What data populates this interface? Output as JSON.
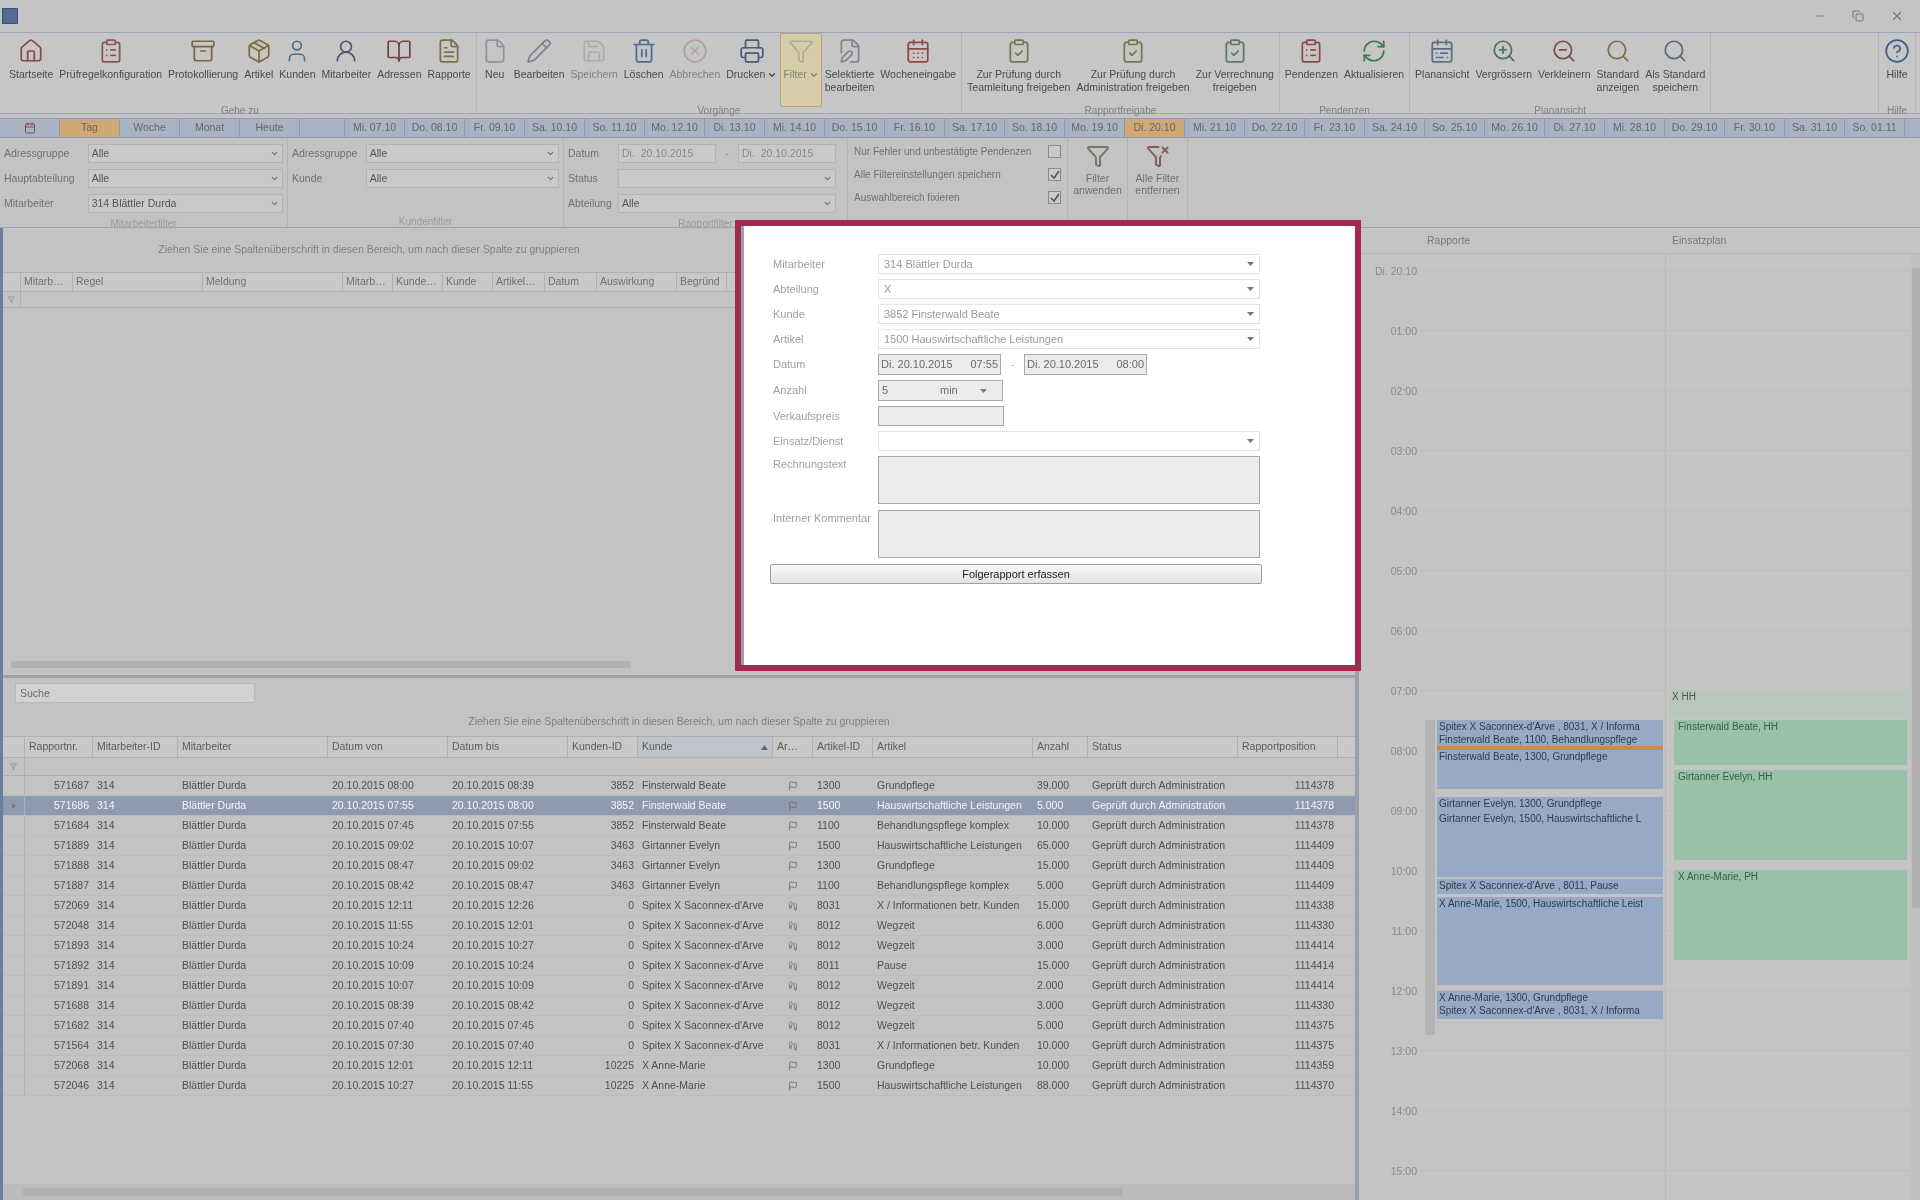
{
  "ribbon": {
    "groups": [
      {
        "caption": "Gehe zu",
        "buttons": [
          {
            "label": "Startseite",
            "disabled": false,
            "selected": false,
            "menu": false
          },
          {
            "label": "Prüfregelkonfiguration",
            "disabled": false,
            "selected": false,
            "menu": false
          },
          {
            "label": "Protokollierung",
            "disabled": false,
            "selected": false,
            "menu": false
          },
          {
            "label": "Artikel",
            "disabled": false,
            "selected": false,
            "menu": false
          },
          {
            "label": "Kunden",
            "disabled": false,
            "selected": false,
            "menu": false
          },
          {
            "label": "Mitarbeiter",
            "disabled": false,
            "selected": false,
            "menu": false
          },
          {
            "label": "Adressen",
            "disabled": false,
            "selected": false,
            "menu": false
          },
          {
            "label": "Rapporte",
            "disabled": false,
            "selected": false,
            "menu": false
          }
        ]
      },
      {
        "caption": "Vorgänge",
        "buttons": [
          {
            "label": "Neu",
            "disabled": false,
            "selected": false,
            "menu": false
          },
          {
            "label": "Bearbeiten",
            "disabled": false,
            "selected": false,
            "menu": false
          },
          {
            "label": "Speichern",
            "disabled": true,
            "selected": false,
            "menu": false
          },
          {
            "label": "Löschen",
            "disabled": false,
            "selected": false,
            "menu": false
          },
          {
            "label": "Abbrechen",
            "disabled": true,
            "selected": false,
            "menu": false
          },
          {
            "label": "Drucken",
            "disabled": false,
            "selected": false,
            "menu": true
          },
          {
            "label": "Filter",
            "disabled": true,
            "selected": true,
            "menu": true
          },
          {
            "label": "Selektierte\nbearbeiten",
            "disabled": false,
            "selected": false,
            "menu": false
          },
          {
            "label": "Wocheneingabe",
            "disabled": false,
            "selected": false,
            "menu": false
          }
        ]
      },
      {
        "caption": "Rapportfreigabe",
        "buttons": [
          {
            "label": "Zur Prüfung durch\nTeamleitung freigeben",
            "disabled": false,
            "selected": false,
            "menu": false
          },
          {
            "label": "Zur Prüfung durch\nAdministration freigeben",
            "disabled": false,
            "selected": false,
            "menu": false
          },
          {
            "label": "Zur Verrechnung\nfreigeben",
            "disabled": false,
            "selected": false,
            "menu": false
          }
        ]
      },
      {
        "caption": "Pendenzen",
        "buttons": [
          {
            "label": "Pendenzen",
            "disabled": false,
            "selected": false,
            "menu": false
          },
          {
            "label": "Aktualisieren",
            "disabled": false,
            "selected": false,
            "menu": false
          }
        ]
      },
      {
        "caption": "Planansicht",
        "buttons": [
          {
            "label": "Planansicht",
            "disabled": false,
            "selected": false,
            "menu": false
          },
          {
            "label": "Vergrössern",
            "disabled": false,
            "selected": false,
            "menu": false
          },
          {
            "label": "Verkleinern",
            "disabled": false,
            "selected": false,
            "menu": false
          },
          {
            "label": "Standard\nanzeigen",
            "disabled": false,
            "selected": false,
            "menu": false
          },
          {
            "label": "Als Standard\nspeichern",
            "disabled": false,
            "selected": false,
            "menu": false
          }
        ]
      },
      {
        "caption": "Hilfe",
        "buttons": [
          {
            "label": "Hilfe",
            "disabled": false,
            "selected": false,
            "menu": false
          }
        ]
      }
    ]
  },
  "date_strip": {
    "views": [
      {
        "label": "Tag",
        "selected": true
      },
      {
        "label": "Woche",
        "selected": false
      },
      {
        "label": "Monat",
        "selected": false
      },
      {
        "label": "Heute",
        "selected": false
      }
    ],
    "days": [
      {
        "label": "Mi. 07.10",
        "selected": false
      },
      {
        "label": "Do. 08.10",
        "selected": false
      },
      {
        "label": "Fr. 09.10",
        "selected": false
      },
      {
        "label": "Sa. 10.10",
        "selected": false
      },
      {
        "label": "So. 11.10",
        "selected": false
      },
      {
        "label": "Mo. 12.10",
        "selected": false
      },
      {
        "label": "Di. 13.10",
        "selected": false
      },
      {
        "label": "Mi. 14.10",
        "selected": false
      },
      {
        "label": "Do. 15.10",
        "selected": false
      },
      {
        "label": "Fr. 16.10",
        "selected": false
      },
      {
        "label": "Sa. 17.10",
        "selected": false
      },
      {
        "label": "So. 18.10",
        "selected": false
      },
      {
        "label": "Mo. 19.10",
        "selected": false
      },
      {
        "label": "Di. 20.10",
        "selected": true
      },
      {
        "label": "Mi. 21.10",
        "selected": false
      },
      {
        "label": "Do. 22.10",
        "selected": false
      },
      {
        "label": "Fr. 23.10",
        "selected": false
      },
      {
        "label": "Sa. 24.10",
        "selected": false
      },
      {
        "label": "So. 25.10",
        "selected": false
      },
      {
        "label": "Mo. 26.10",
        "selected": false
      },
      {
        "label": "Di. 27.10",
        "selected": false
      },
      {
        "label": "Mi. 28.10",
        "selected": false
      },
      {
        "label": "Do. 29.10",
        "selected": false
      },
      {
        "label": "Fr. 30.10",
        "selected": false
      },
      {
        "label": "Sa. 31.10",
        "selected": false
      },
      {
        "label": "So. 01.11",
        "selected": false
      }
    ]
  },
  "filters": {
    "groups": [
      {
        "caption": "Mitarbeiterfilter",
        "fields": [
          {
            "label": "Adressgruppe",
            "value": "Alle"
          },
          {
            "label": "Hauptabteilung",
            "value": "Alle"
          },
          {
            "label": "Mitarbeiter",
            "value": "314 Blättler Durda"
          }
        ]
      },
      {
        "caption": "Kundenfilter",
        "fields": [
          {
            "label": "Adressgruppe",
            "value": "Alle"
          },
          {
            "label": "Kunde",
            "value": "Alle"
          }
        ]
      },
      {
        "caption": "Rapportfilter",
        "date": {
          "label": "Datum",
          "from": "Di.  20.10.2015",
          "separator": "-",
          "to": "Di.  20.10.2015"
        },
        "fields": [
          {
            "label": "Status"
          },
          {
            "label": "Abteilung",
            "value": "Alle"
          }
        ]
      }
    ],
    "options": [
      {
        "label": "Nur Fehler und unbestätigte Pendenzen",
        "checked": false
      },
      {
        "label": "Alle Filtereinstellungen speichern",
        "checked": true
      },
      {
        "label": "Auswahlbereich fixieren",
        "checked": true
      }
    ],
    "buttons": [
      "Filter\nanwenden",
      "Alle Filter\nentfernen"
    ]
  },
  "check_grid": {
    "group_hint": "Ziehen Sie eine Spaltenüberschrift in diesen Bereich, um nach dieser Spalte zu gruppieren",
    "columns": [
      "Mitarb…",
      "Regel",
      "Meldung",
      "Mitarb…",
      "Kunde…",
      "Kunde",
      "Artikel…",
      "Datum",
      "Auswirkung",
      "Begründ"
    ]
  },
  "report_grid": {
    "search": {
      "placeholder": "Suche"
    },
    "group_hint": "Ziehen Sie eine Spaltenüberschrift in diesen Bereich, um nach dieser Spalte zu gruppieren",
    "columns": [
      {
        "label": "Rapportnr.",
        "sorted": false
      },
      {
        "label": "Mitarbeiter-ID",
        "sorted": false
      },
      {
        "label": "Mitarbeiter",
        "sorted": false
      },
      {
        "label": "Datum von",
        "sorted": false
      },
      {
        "label": "Datum bis",
        "sorted": false
      },
      {
        "label": "Kunden-ID",
        "sorted": false
      },
      {
        "label": "Kunde",
        "sorted": true
      },
      {
        "label": "Ar…",
        "sorted": false
      },
      {
        "label": "Artikel-ID",
        "sorted": false
      },
      {
        "label": "Artikel",
        "sorted": false
      },
      {
        "label": "Anzahl",
        "sorted": false
      },
      {
        "label": "Status",
        "sorted": false
      },
      {
        "label": "Rapportposition",
        "sorted": false
      }
    ],
    "rows": [
      {
        "selected": false,
        "cells": [
          "571687",
          "314",
          "Blättler Durda",
          "20.10.2015 08:00",
          "20.10.2015 08:39",
          "3852",
          "Finsterwald Beate",
          {
            "kind": "client"
          },
          "1300",
          "Grundpflege",
          "39.000",
          "Geprüft durch Administration",
          "1114378"
        ]
      },
      {
        "selected": true,
        "cells": [
          "571686",
          "314",
          "Blättler Durda",
          "20.10.2015 07:55",
          "20.10.2015 08:00",
          "3852",
          "Finsterwald Beate",
          {
            "kind": "client"
          },
          "1500",
          "Hauswirtschaftliche Leistungen",
          "5.000",
          "Geprüft durch Administration",
          "1114378"
        ]
      },
      {
        "selected": false,
        "cells": [
          "571684",
          "314",
          "Blättler Durda",
          "20.10.2015 07:45",
          "20.10.2015 07:55",
          "3852",
          "Finsterwald Beate",
          {
            "kind": "client"
          },
          "1100",
          "Behandlungspflege komplex",
          "10.000",
          "Geprüft durch Administration",
          "1114378"
        ]
      },
      {
        "selected": false,
        "cells": [
          "571889",
          "314",
          "Blättler Durda",
          "20.10.2015 09:02",
          "20.10.2015 10:07",
          "3463",
          "Girtanner Evelyn",
          {
            "kind": "client"
          },
          "1500",
          "Hauswirtschaftliche Leistungen",
          "65.000",
          "Geprüft durch Administration",
          "1114409"
        ]
      },
      {
        "selected": false,
        "cells": [
          "571888",
          "314",
          "Blättler Durda",
          "20.10.2015 08:47",
          "20.10.2015 09:02",
          "3463",
          "Girtanner Evelyn",
          {
            "kind": "client"
          },
          "1300",
          "Grundpflege",
          "15.000",
          "Geprüft durch Administration",
          "1114409"
        ]
      },
      {
        "selected": false,
        "cells": [
          "571887",
          "314",
          "Blättler Durda",
          "20.10.2015 08:42",
          "20.10.2015 08:47",
          "3463",
          "Girtanner Evelyn",
          {
            "kind": "client"
          },
          "1100",
          "Behandlungspflege komplex",
          "5.000",
          "Geprüft durch Administration",
          "1114409"
        ]
      },
      {
        "selected": false,
        "cells": [
          "572069",
          "314",
          "Blättler Durda",
          "20.10.2015 12:11",
          "20.10.2015 12:26",
          "0",
          "Spitex X Saconnex-d'Arve",
          {
            "kind": "internal"
          },
          "8031",
          "X / Informationen betr. Kunden",
          "15.000",
          "Geprüft durch Administration",
          "1114338"
        ]
      },
      {
        "selected": false,
        "cells": [
          "572048",
          "314",
          "Blättler Durda",
          "20.10.2015 11:55",
          "20.10.2015 12:01",
          "0",
          "Spitex X Saconnex-d'Arve",
          {
            "kind": "internal"
          },
          "8012",
          "Wegzeit",
          "6.000",
          "Geprüft durch Administration",
          "1114330"
        ]
      },
      {
        "selected": false,
        "cells": [
          "571893",
          "314",
          "Blättler Durda",
          "20.10.2015 10:24",
          "20.10.2015 10:27",
          "0",
          "Spitex X Saconnex-d'Arve",
          {
            "kind": "internal"
          },
          "8012",
          "Wegzeit",
          "3.000",
          "Geprüft durch Administration",
          "1114414"
        ]
      },
      {
        "selected": false,
        "cells": [
          "571892",
          "314",
          "Blättler Durda",
          "20.10.2015 10:09",
          "20.10.2015 10:24",
          "0",
          "Spitex X Saconnex-d'Arve",
          {
            "kind": "internal"
          },
          "8011",
          "Pause",
          "15.000",
          "Geprüft durch Administration",
          "1114414"
        ]
      },
      {
        "selected": false,
        "cells": [
          "571891",
          "314",
          "Blättler Durda",
          "20.10.2015 10:07",
          "20.10.2015 10:09",
          "0",
          "Spitex X Saconnex-d'Arve",
          {
            "kind": "internal"
          },
          "8012",
          "Wegzeit",
          "2.000",
          "Geprüft durch Administration",
          "1114414"
        ]
      },
      {
        "selected": false,
        "cells": [
          "571688",
          "314",
          "Blättler Durda",
          "20.10.2015 08:39",
          "20.10.2015 08:42",
          "0",
          "Spitex X Saconnex-d'Arve",
          {
            "kind": "internal"
          },
          "8012",
          "Wegzeit",
          "3.000",
          "Geprüft durch Administration",
          "1114330"
        ]
      },
      {
        "selected": false,
        "cells": [
          "571682",
          "314",
          "Blättler Durda",
          "20.10.2015 07:40",
          "20.10.2015 07:45",
          "0",
          "Spitex X Saconnex-d'Arve",
          {
            "kind": "internal"
          },
          "8012",
          "Wegzeit",
          "5.000",
          "Geprüft durch Administration",
          "1114375"
        ]
      },
      {
        "selected": false,
        "cells": [
          "571564",
          "314",
          "Blättler Durda",
          "20.10.2015 07:30",
          "20.10.2015 07:40",
          "0",
          "Spitex X Saconnex-d'Arve",
          {
            "kind": "internal"
          },
          "8031",
          "X / Informationen betr. Kunden",
          "10.000",
          "Geprüft durch Administration",
          "1114375"
        ]
      },
      {
        "selected": false,
        "cells": [
          "572068",
          "314",
          "Blättler Durda",
          "20.10.2015 12:01",
          "20.10.2015 12:11",
          "10225",
          "X Anne-Marie",
          {
            "kind": "client"
          },
          "1300",
          "Grundpflege",
          "10.000",
          "Geprüft durch Administration",
          "1114359"
        ]
      },
      {
        "selected": false,
        "cells": [
          "572046",
          "314",
          "Blättler Durda",
          "20.10.2015 10:27",
          "20.10.2015 11:55",
          "10225",
          "X Anne-Marie",
          {
            "kind": "client"
          },
          "1500",
          "Hauswirtschaftliche Leistungen",
          "88.000",
          "Geprüft durch Administration",
          "1114370"
        ]
      }
    ]
  },
  "planner": {
    "columns": [
      "Rapporte",
      "Einsatzplan"
    ],
    "hours": [
      "Di. 20.10",
      "01:00",
      "02:00",
      "03:00",
      "04:00",
      "05:00",
      "06:00",
      "07:00",
      "08:00",
      "09:00",
      "10:00",
      "11:00",
      "12:00",
      "13:00",
      "14:00",
      "15:00"
    ],
    "reports": [
      {
        "text": "Spitex X Saconnex-d'Arve , 8031, X / Informa",
        "selected": false
      },
      {
        "text": "Finsterwald Beate, 1100, Behandlungspflege",
        "selected": false
      },
      {
        "selected": true
      },
      {
        "text": "Finsterwald Beate, 1300, Grundpflege",
        "selected": false
      },
      {
        "text": "Girtanner Evelyn, 1300, Grundpflege",
        "selected": false
      },
      {
        "text": "Girtanner Evelyn, 1500, Hauswirtschaftliche L",
        "selected": false
      },
      {
        "text": "Spitex X Saconnex-d'Arve , 8011, Pause",
        "selected": false
      },
      {
        "text": "X Anne-Marie, 1500, Hauswirtschaftliche Leist",
        "selected": false
      },
      {
        "text": "X Anne-Marie, 1300, Grundpflege",
        "selected": false
      },
      {
        "text": "Spitex X Saconnex-d'Arve , 8031, X / Informa",
        "selected": false
      }
    ],
    "assignments": [
      {
        "text": "X HH",
        "kind": "shift"
      },
      {
        "text": "Finsterwald Beate, HH",
        "kind": "visit"
      },
      {
        "text": "Girtanner Evelyn, HH",
        "kind": "visit"
      },
      {
        "text": "X Anne-Marie, PH",
        "kind": "visit"
      }
    ]
  },
  "dialog": {
    "fields": [
      {
        "label": "Mitarbeiter",
        "kind": "dropdown",
        "value": "314 Blättler Durda"
      },
      {
        "label": "Abteilung",
        "kind": "dropdown",
        "value": "X"
      },
      {
        "label": "Kunde",
        "kind": "dropdown",
        "value": "3852 Finsterwald Beate"
      },
      {
        "label": "Artikel",
        "kind": "dropdown",
        "value": "1500 Hauswirtschaftliche Leistungen"
      },
      {
        "label": "Datum",
        "kind": "daterange",
        "from": [
          "Di.",
          "20.10.2015",
          "07:55"
        ],
        "separator": "-",
        "to": [
          "Di.",
          "20.10.2015",
          "08:00"
        ]
      },
      {
        "label": "Anzahl",
        "kind": "quantity",
        "value": "5",
        "unit": "min"
      },
      {
        "label": "Verkaufspreis",
        "kind": "text"
      },
      {
        "label": "Einsatz/Dienst",
        "kind": "dropdown"
      },
      {
        "label": "Rechnungstext",
        "kind": "memo"
      },
      {
        "label": "Interner Kommentar",
        "kind": "memo"
      }
    ],
    "button": "Folgerapport erfassen"
  }
}
